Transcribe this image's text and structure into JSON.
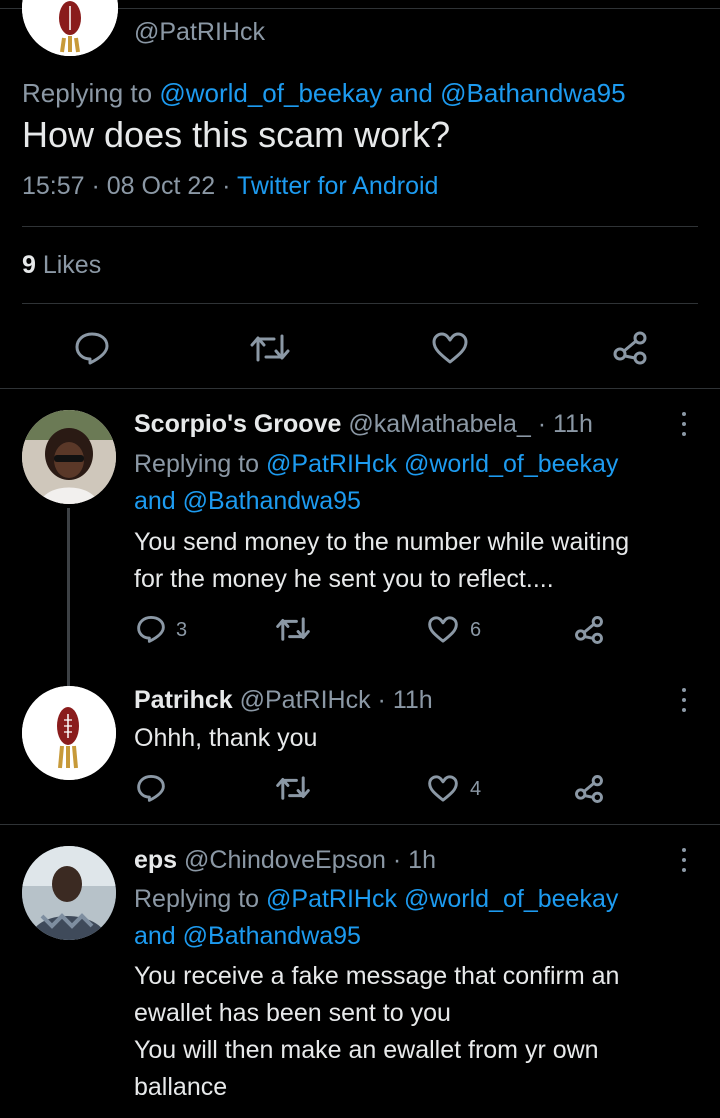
{
  "top_tweet": {
    "handle": "@PatRIHck",
    "replying_prefix": "Replying to ",
    "replying_to_1": "@world_of_beekay",
    "replying_and": " and ",
    "replying_to_2": "@Bathandwa95",
    "text": "How does this scam work?",
    "time": "15:57",
    "date": "08 Oct 22",
    "source": "Twitter for Android",
    "likes_count": "9",
    "likes_label": " Likes"
  },
  "replies": [
    {
      "name": "Scorpio's Groove",
      "handle": "@kaMathabela_",
      "age": "11h",
      "replying_prefix": "Replying to ",
      "replying_to_1": "@PatRIHck",
      "replying_to_2": "@world_of_beekay",
      "replying_and": "and ",
      "replying_to_3": "@Bathandwa95",
      "text_line_1": "You send money to the number while waiting",
      "text_line_2": "for the money he sent you to reflect....",
      "reply_count": "3",
      "retweet_count": "",
      "like_count": "6"
    },
    {
      "name": "Patrihck",
      "handle": "@PatRIHck",
      "age": "11h",
      "text_line_1": "Ohhh, thank you",
      "reply_count": "",
      "retweet_count": "",
      "like_count": "4"
    },
    {
      "name": "eps",
      "handle": "@ChindoveEpson",
      "age": "1h",
      "replying_prefix": "Replying to ",
      "replying_to_1": "@PatRIHck",
      "replying_to_2": "@world_of_beekay",
      "replying_and": "and ",
      "replying_to_3": "@Bathandwa95",
      "text_line_1": "You receive a fake message that confirm an",
      "text_line_2": "ewallet has been sent to you",
      "text_line_3": "You will then make an ewallet from yr own",
      "text_line_4": "ballance"
    }
  ],
  "separator": " · ",
  "colors": {
    "background": "#000000",
    "text": "#e7e9ea",
    "muted": "#8b98a5",
    "link": "#1d9bf0",
    "divider": "#2f3336"
  },
  "icons": [
    "reply-icon",
    "retweet-icon",
    "like-icon",
    "share-icon",
    "more-icon"
  ]
}
